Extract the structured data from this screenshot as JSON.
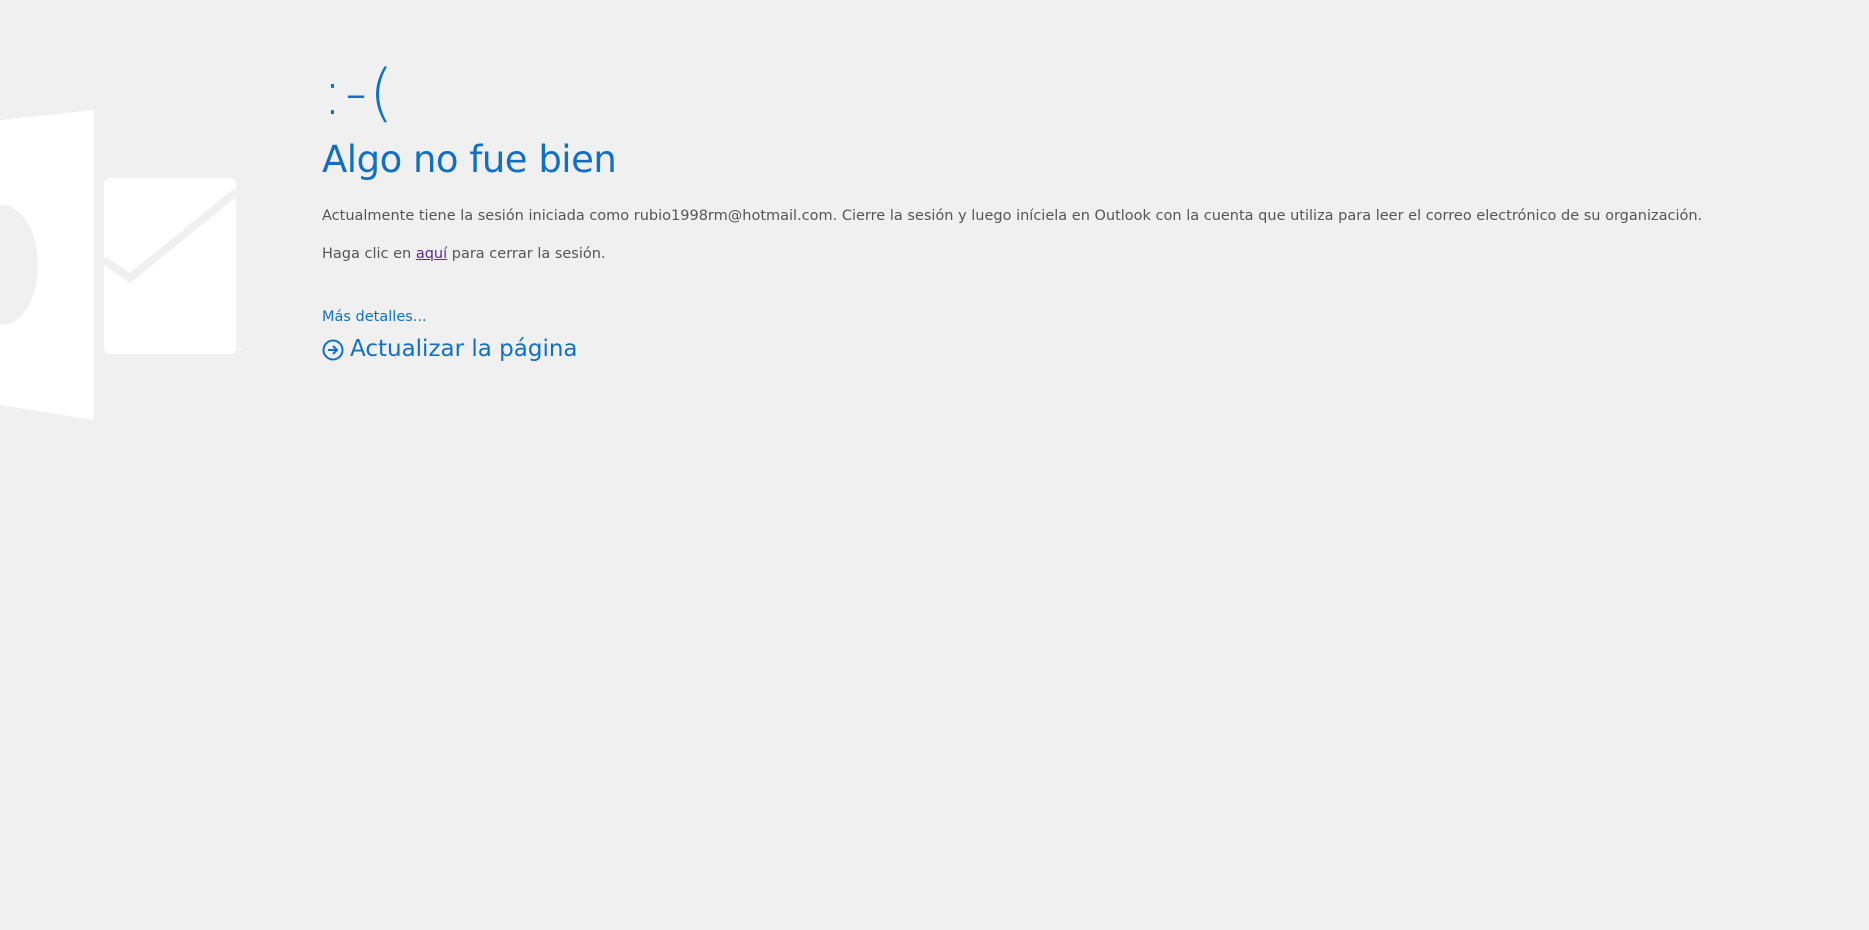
{
  "error": {
    "emoticon": ":-(",
    "title": "Algo no fue bien",
    "message": "Actualmente tiene la sesión iniciada como rubio1998rm@hotmail.com. Cierre la sesión y luego iníciela en Outlook con la cuenta que utiliza para leer el correo electrónico de su organización.",
    "signout_prefix": "Haga clic en ",
    "signout_link": "aquí",
    "signout_suffix": " para cerrar la sesión.",
    "details_link": "Más detalles...",
    "refresh_label": "Actualizar la página"
  },
  "icons": {
    "background_logo": "outlook-logo-icon",
    "refresh": "circle-arrow-right-icon"
  },
  "colors": {
    "background": "#f0f0f0",
    "accent": "#1170c4",
    "text": "#555555",
    "visited_link": "#5b2c8c",
    "logo": "#ffffff"
  }
}
